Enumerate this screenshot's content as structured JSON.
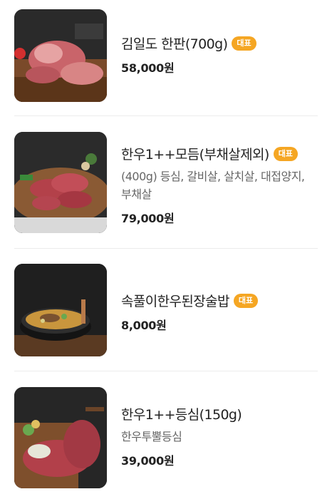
{
  "menu": {
    "items": [
      {
        "title": "김일도 한판(700g)",
        "badge": "대표",
        "description": "",
        "price": "58,000원"
      },
      {
        "title": "한우1++모듬(부채살제외)",
        "badge": "대표",
        "description": "(400g) 등심, 갈비살, 살치살, 대접양지, 부채살",
        "price": "79,000원"
      },
      {
        "title": "속풀이한우된장술밥",
        "badge": "대표",
        "description": "",
        "price": "8,000원"
      },
      {
        "title": "한우1++등심(150g)",
        "badge": "",
        "description": "한우투뿔등심",
        "price": "39,000원"
      }
    ]
  },
  "colors": {
    "badge": "#f5a623",
    "price": "#222222",
    "description": "#666666",
    "divider": "#ececec"
  }
}
